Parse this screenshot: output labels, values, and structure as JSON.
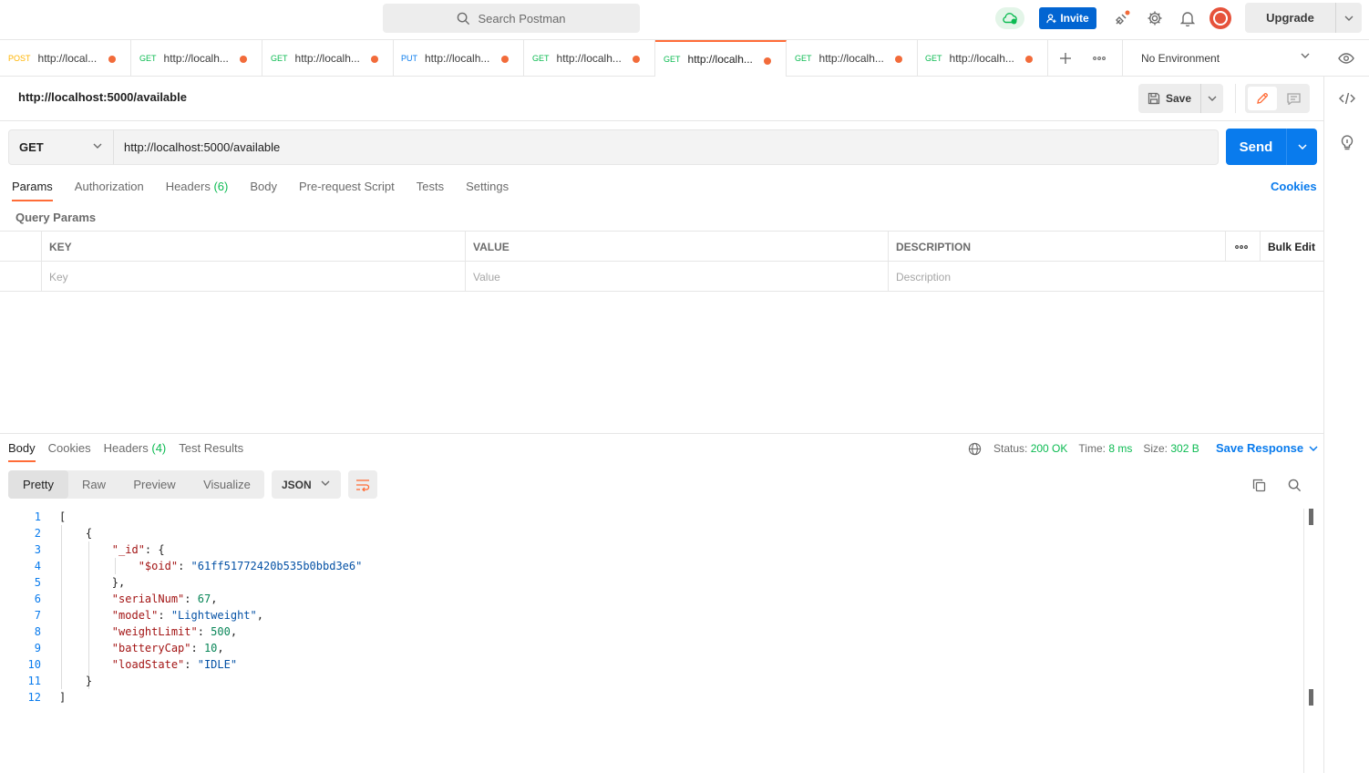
{
  "topbar": {
    "search_placeholder": "Search Postman",
    "invite_label": "Invite",
    "upgrade_label": "Upgrade"
  },
  "tabs": [
    {
      "method": "POST",
      "url": "http://local...",
      "active": false
    },
    {
      "method": "GET",
      "url": "http://localh...",
      "active": false
    },
    {
      "method": "GET",
      "url": "http://localh...",
      "active": false
    },
    {
      "method": "PUT",
      "url": "http://localh...",
      "active": false
    },
    {
      "method": "GET",
      "url": "http://localh...",
      "active": false
    },
    {
      "method": "GET",
      "url": "http://localh...",
      "active": true
    },
    {
      "method": "GET",
      "url": "http://localh...",
      "active": false
    },
    {
      "method": "GET",
      "url": "http://localh...",
      "active": false
    }
  ],
  "environment": "No Environment",
  "request": {
    "title": "http://localhost:5000/available",
    "save_label": "Save",
    "method": "GET",
    "url": "http://localhost:5000/available",
    "send_label": "Send",
    "tabs": {
      "params": "Params",
      "authorization": "Authorization",
      "headers": "Headers",
      "headers_count": "(6)",
      "body": "Body",
      "prerequest": "Pre-request Script",
      "tests": "Tests",
      "settings": "Settings"
    },
    "cookies_label": "Cookies",
    "query_params_title": "Query Params",
    "params_table": {
      "key_header": "KEY",
      "value_header": "VALUE",
      "description_header": "DESCRIPTION",
      "bulk_edit": "Bulk Edit",
      "key_placeholder": "Key",
      "value_placeholder": "Value",
      "description_placeholder": "Description"
    }
  },
  "response": {
    "tabs": {
      "body": "Body",
      "cookies": "Cookies",
      "headers": "Headers",
      "headers_count": "(4)",
      "test_results": "Test Results"
    },
    "status_label": "Status:",
    "status_value": "200 OK",
    "time_label": "Time:",
    "time_value": "8 ms",
    "size_label": "Size:",
    "size_value": "302 B",
    "save_response": "Save Response",
    "views": {
      "pretty": "Pretty",
      "raw": "Raw",
      "preview": "Preview",
      "visualize": "Visualize"
    },
    "format": "JSON",
    "body_lines": [
      {
        "n": "1",
        "html": "["
      },
      {
        "n": "2",
        "html": "    {"
      },
      {
        "n": "3",
        "html": "        <span class=\"k\">\"_id\"</span>: {"
      },
      {
        "n": "4",
        "html": "            <span class=\"k\">\"$oid\"</span>: <span class=\"s\">\"61ff51772420b535b0bbd3e6\"</span>"
      },
      {
        "n": "5",
        "html": "        },"
      },
      {
        "n": "6",
        "html": "        <span class=\"k\">\"serialNum\"</span>: <span class=\"n\">67</span>,"
      },
      {
        "n": "7",
        "html": "        <span class=\"k\">\"model\"</span>: <span class=\"s\">\"Lightweight\"</span>,"
      },
      {
        "n": "8",
        "html": "        <span class=\"k\">\"weightLimit\"</span>: <span class=\"n\">500</span>,"
      },
      {
        "n": "9",
        "html": "        <span class=\"k\">\"batteryCap\"</span>: <span class=\"n\">10</span>,"
      },
      {
        "n": "10",
        "html": "        <span class=\"k\">\"loadState\"</span>: <span class=\"s\">\"IDLE\"</span>"
      },
      {
        "n": "11",
        "html": "    }"
      },
      {
        "n": "12",
        "html": "]"
      }
    ]
  },
  "colors": {
    "accent_orange": "#ff6c37",
    "brand_blue": "#097bed",
    "get_green": "#0cbb52",
    "post_yellow": "#ffb400",
    "put_blue": "#097bed"
  }
}
